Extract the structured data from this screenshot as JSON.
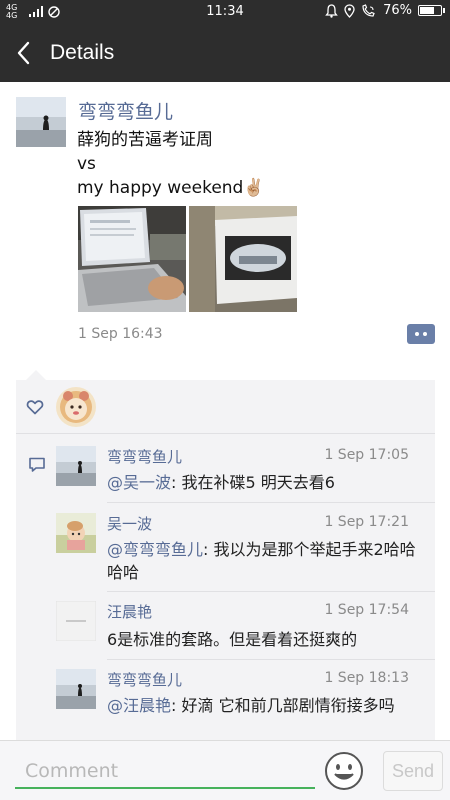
{
  "status_bar": {
    "network": "4G 4G",
    "time": "11:34",
    "battery_percent": "76%",
    "battery_level": 0.76,
    "icons": [
      "signal-icon",
      "no-disturb-icon",
      "bell-icon",
      "location-icon",
      "call-wifi-icon",
      "battery-icon"
    ]
  },
  "header": {
    "title": "Details",
    "back_icon": "chevron-left-icon"
  },
  "post": {
    "author": "弯弯弯鱼儿",
    "lines": [
      "薛狗的苦逼考证周",
      "vs",
      "my happy weekend✌🏼"
    ],
    "photos": [
      "laptop-photo",
      "desk-photo"
    ],
    "time": "1 Sep 16:43",
    "action_icon": "comment-more-icon"
  },
  "likes": {
    "icon": "heart-icon"
  },
  "comments": [
    {
      "author": "弯弯弯鱼儿",
      "time": "1 Sep 17:05",
      "mention": "@吴一波",
      "text": ": 我在补碟5 明天去看6"
    },
    {
      "author": "吴一波",
      "time": "1 Sep 17:21",
      "mention": "@弯弯弯鱼儿",
      "text": ": 我以为是那个举起手来2哈哈哈哈"
    },
    {
      "author": "汪晨艳",
      "time": "1 Sep 17:54",
      "mention": "",
      "text": "6是标准的套路。但是看着还挺爽的"
    },
    {
      "author": "弯弯弯鱼儿",
      "time": "1 Sep 18:13",
      "mention": "@汪晨艳",
      "text": ": 好滴 它和前几部剧情衔接多吗"
    }
  ],
  "input": {
    "placeholder": "Comment",
    "send_label": "Send",
    "emoji_icon": "emoji-icon"
  },
  "colors": {
    "link": "#576b95",
    "bar": "#2d2d2d",
    "accent": "#47b25c"
  }
}
